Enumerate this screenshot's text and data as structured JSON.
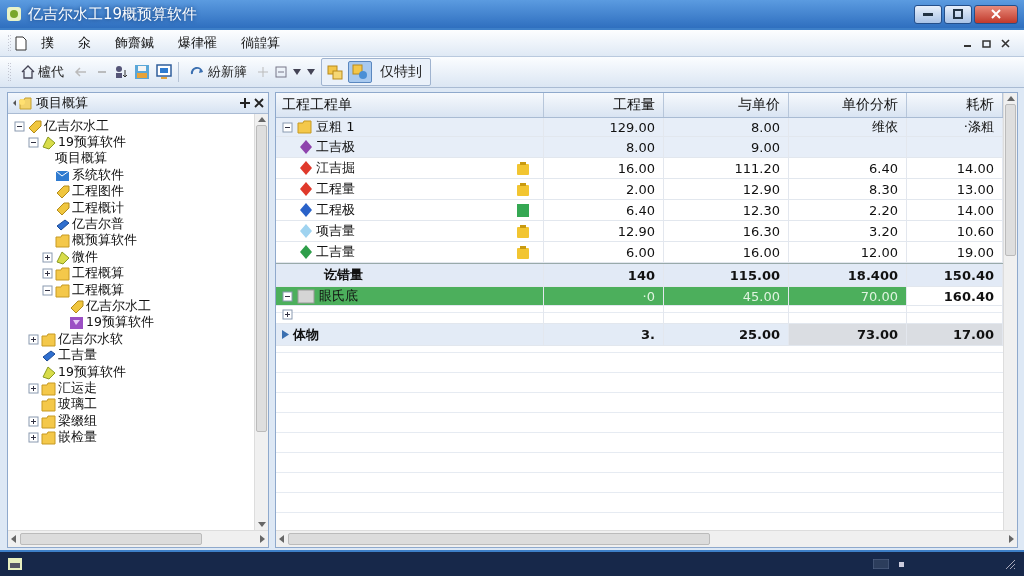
{
  "window": {
    "title": "亿吉尔水工19概预算软件"
  },
  "menu": [
    "撲",
    "氽",
    "飾齋鍼",
    "爆律罹",
    "徜韹算"
  ],
  "toolbar": {
    "home_label": "櫨代",
    "refresh_label": "紛新簲",
    "toggles": [
      {
        "selected": false
      },
      {
        "selected": true
      }
    ],
    "view_label": "仅特刲"
  },
  "tree_panel": {
    "title": "项目概算",
    "items": [
      {
        "label": "亿吉尔水工",
        "kind": "tag",
        "expanded": true,
        "children": [
          {
            "label": "19预算软件",
            "kind": "leaf",
            "expanded": true,
            "children": [
              {
                "label": "项目概算",
                "kind": "none"
              },
              {
                "label": "系统软件",
                "kind": "mail"
              },
              {
                "label": "工程图件",
                "kind": "tag"
              },
              {
                "label": "工程概计",
                "kind": "tag"
              },
              {
                "label": "亿吉尔普",
                "kind": "cube"
              },
              {
                "label": "概预算软件",
                "kind": "folder"
              },
              {
                "label": "微件",
                "kind": "leaf",
                "expanded": false
              },
              {
                "label": "工程概算",
                "kind": "folder",
                "expanded": false
              },
              {
                "label": "工程概算",
                "kind": "folder",
                "expanded": true,
                "children": [
                  {
                    "label": "亿吉尔水工",
                    "kind": "tag"
                  },
                  {
                    "label": "19预算软件",
                    "kind": "note"
                  }
                ]
              }
            ]
          },
          {
            "label": "亿吉尔水软",
            "kind": "folder",
            "expanded": false
          },
          {
            "label": "工吉量",
            "kind": "cube"
          },
          {
            "label": "19预算软件",
            "kind": "leaf"
          },
          {
            "label": "汇运走",
            "kind": "folder",
            "expanded": false
          },
          {
            "label": "玻璃工",
            "kind": "folder"
          },
          {
            "label": "梁缀组",
            "kind": "folder",
            "expanded": false
          },
          {
            "label": "嵌检量",
            "kind": "folder",
            "expanded": false
          }
        ]
      }
    ]
  },
  "table": {
    "columns": [
      "工程工程单",
      "工程量",
      "与单价",
      "单价分析",
      "耗析"
    ],
    "rows": [
      {
        "kind": "group",
        "label": "豆粗 1",
        "expanded": true,
        "selected": false,
        "values": [
          "129.00",
          "8.00",
          "维依",
          "·涤粗"
        ]
      },
      {
        "kind": "item",
        "label": "工吉极",
        "color": "#8e44ad",
        "selected": false,
        "values": [
          "8.00",
          "9.00"
        ]
      },
      {
        "kind": "item",
        "label": "江吉掘",
        "color": "#e0392b",
        "done": false,
        "selected": false,
        "values": [
          "16.00",
          "111.20",
          "6.40",
          "14.00"
        ]
      },
      {
        "kind": "item",
        "label": "工程量",
        "color": "#e0392b",
        "done": false,
        "selected": false,
        "values": [
          "2.00",
          "12.90",
          "8.30",
          "13.00"
        ]
      },
      {
        "kind": "item",
        "label": "工程极",
        "color": "#2a62c9",
        "done": true,
        "selected": false,
        "values": [
          "6.40",
          "12.30",
          "2.20",
          "14.00"
        ]
      },
      {
        "kind": "item",
        "label": "项吉量",
        "color": "#9fd3f0",
        "done": false,
        "selected": false,
        "values": [
          "12.90",
          "16.30",
          "3.20",
          "10.60"
        ]
      },
      {
        "kind": "item",
        "label": "工吉量",
        "color": "#2e9e4a",
        "done": false,
        "selected": false,
        "values": [
          "6.00",
          "16.00",
          "12.00",
          "19.00"
        ]
      },
      {
        "kind": "subtotal",
        "label": "讫错量",
        "selected": false,
        "values": [
          "140",
          "115.00",
          "18.400",
          "150.40"
        ]
      },
      {
        "kind": "group",
        "label": "眼氏底",
        "expanded": true,
        "selected": true,
        "values": [
          "·0",
          "45.00",
          "70.00",
          "160.40"
        ]
      },
      {
        "kind": "empty",
        "expanded": false,
        "selected": false
      },
      {
        "kind": "total",
        "label": "体物",
        "selected": false,
        "values": [
          "3.",
          "25.00",
          "73.00",
          "17.00"
        ]
      }
    ]
  }
}
